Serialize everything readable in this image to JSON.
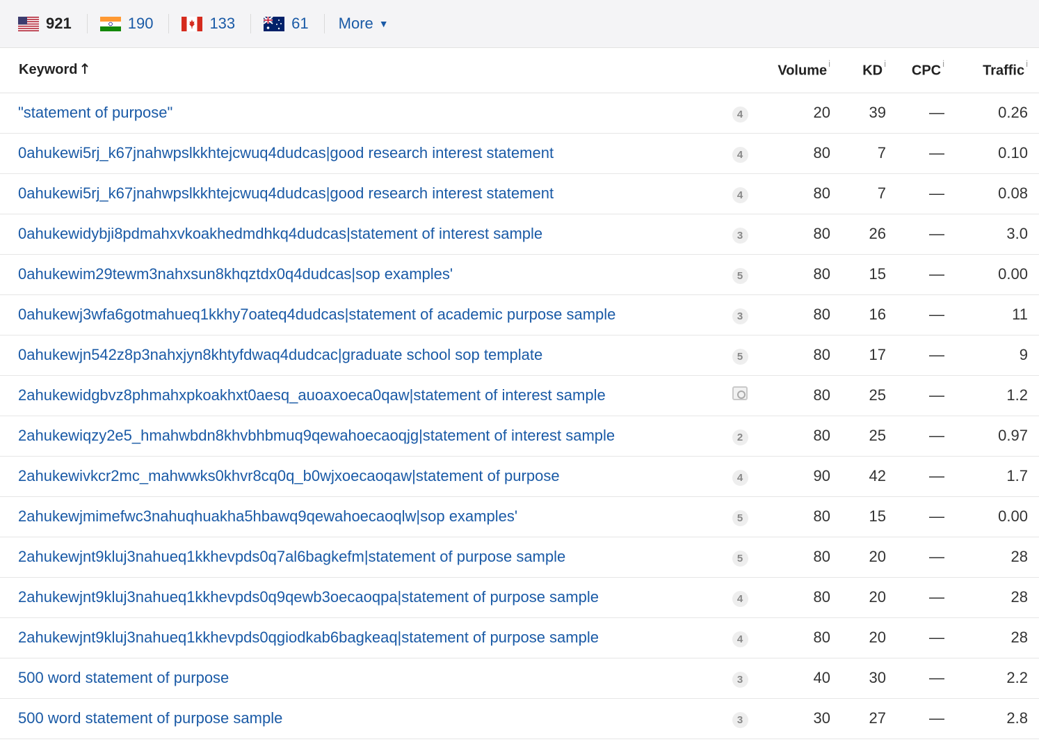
{
  "countries": [
    {
      "code": "US",
      "count": "921",
      "active": true
    },
    {
      "code": "IN",
      "count": "190",
      "active": false
    },
    {
      "code": "CA",
      "count": "133",
      "active": false
    },
    {
      "code": "AU",
      "count": "61",
      "active": false
    }
  ],
  "more_label": "More",
  "columns": {
    "keyword": "Keyword",
    "sort_icon": "arrow-up-icon",
    "volume": "Volume",
    "kd": "KD",
    "cpc": "CPC",
    "traffic": "Traffic",
    "info": "i"
  },
  "rows": [
    {
      "keyword": "\"statement of purpose\"",
      "position": "4",
      "volume": "20",
      "kd": "39",
      "cpc": "—",
      "traffic": "0.26"
    },
    {
      "keyword": "0ahukewi5rj_k67jnahwpslkkhtejcwuq4dudcas|good research interest statement",
      "position": "4",
      "volume": "80",
      "kd": "7",
      "cpc": "—",
      "traffic": "0.10"
    },
    {
      "keyword": "0ahukewi5rj_k67jnahwpslkkhtejcwuq4dudcas|good research interest statement",
      "position": "4",
      "volume": "80",
      "kd": "7",
      "cpc": "—",
      "traffic": "0.08"
    },
    {
      "keyword": "0ahukewidybji8pdmahxvkoakhedmdhkq4dudcas|statement of interest sample",
      "position": "3",
      "volume": "80",
      "kd": "26",
      "cpc": "—",
      "traffic": "3.0"
    },
    {
      "keyword": "0ahukewim29tewm3nahxsun8khqztdx0q4dudcas|sop examples'",
      "position": "5",
      "volume": "80",
      "kd": "15",
      "cpc": "—",
      "traffic": "0.00"
    },
    {
      "keyword": "0ahukewj3wfa6gotmahueq1kkhy7oateq4dudcas|statement of academic purpose sample",
      "position": "3",
      "volume": "80",
      "kd": "16",
      "cpc": "—",
      "traffic": "11"
    },
    {
      "keyword": "0ahukewjn542z8p3nahxjyn8khtyfdwaq4dudcac|graduate school sop template",
      "position": "5",
      "volume": "80",
      "kd": "17",
      "cpc": "—",
      "traffic": "9"
    },
    {
      "keyword": "2ahukewidgbvz8phmahxpkoakhxt0aesq_auoaxoeca0qaw|statement of interest sample",
      "position": "",
      "icon": "image-icon",
      "volume": "80",
      "kd": "25",
      "cpc": "—",
      "traffic": "1.2"
    },
    {
      "keyword": "2ahukewiqzy2e5_hmahwbdn8khvbhbmuq9qewahoecaoqjg|statement of interest sample",
      "position": "2",
      "volume": "80",
      "kd": "25",
      "cpc": "—",
      "traffic": "0.97"
    },
    {
      "keyword": "2ahukewivkcr2mc_mahwwks0khvr8cq0q_b0wjxoecaoqaw|statement of purpose",
      "position": "4",
      "volume": "90",
      "kd": "42",
      "cpc": "—",
      "traffic": "1.7"
    },
    {
      "keyword": "2ahukewjmimefwc3nahuqhuakha5hbawq9qewahoecaoqlw|sop examples'",
      "position": "5",
      "volume": "80",
      "kd": "15",
      "cpc": "—",
      "traffic": "0.00"
    },
    {
      "keyword": "2ahukewjnt9kluj3nahueq1kkhevpds0q7al6bagkefm|statement of purpose sample",
      "position": "5",
      "volume": "80",
      "kd": "20",
      "cpc": "—",
      "traffic": "28"
    },
    {
      "keyword": "2ahukewjnt9kluj3nahueq1kkhevpds0q9qewb3oecaoqpa|statement of purpose sample",
      "position": "4",
      "volume": "80",
      "kd": "20",
      "cpc": "—",
      "traffic": "28"
    },
    {
      "keyword": "2ahukewjnt9kluj3nahueq1kkhevpds0qgiodkab6bagkeaq|statement of purpose sample",
      "position": "4",
      "volume": "80",
      "kd": "20",
      "cpc": "—",
      "traffic": "28"
    },
    {
      "keyword": "500 word statement of purpose",
      "position": "3",
      "volume": "40",
      "kd": "30",
      "cpc": "—",
      "traffic": "2.2"
    },
    {
      "keyword": "500 word statement of purpose sample",
      "position": "3",
      "volume": "30",
      "kd": "27",
      "cpc": "—",
      "traffic": "2.8"
    }
  ],
  "colors": {
    "link": "#1a5aa6",
    "topbar": "#f4f4f6",
    "badge": "#eeeeee"
  }
}
